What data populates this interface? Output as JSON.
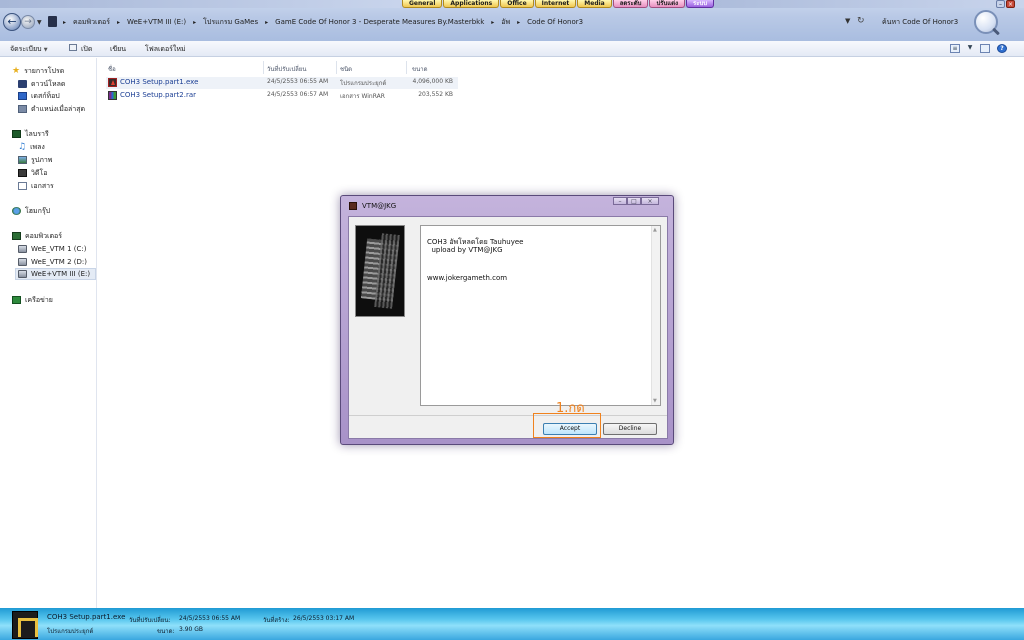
{
  "launcher": {
    "tabs": [
      "General",
      "Applications",
      "Office",
      "Internet",
      "Media",
      "ลดระดับ",
      "ปรับแต่ง",
      "ระบบ"
    ]
  },
  "address_bar": {
    "breadcrumb": [
      "คอมพิวเตอร์",
      "WeE+VTM III (E:)",
      "โปรแกรม GaMes",
      "GamE Code Of Honor 3 - Desperate Measures By.Masterbkk",
      "อัพ",
      "Code Of Honor3"
    ],
    "search_placeholder": "ค้นหา Code Of Honor3"
  },
  "command_bar": {
    "organize": "จัดระเบียบ",
    "open": "เปิด",
    "burn": "เขียน",
    "new_folder": "โฟลเดอร์ใหม่"
  },
  "sidebar": {
    "favorites": {
      "label": "รายการโปรด",
      "items": [
        "ดาวน์โหลด",
        "เดสก์ท็อป",
        "ตำแหน่งเมื่อล่าสุด"
      ]
    },
    "libraries": {
      "label": "ไลบรารี",
      "items": [
        "เพลง",
        "รูปภาพ",
        "วิดีโอ",
        "เอกสาร"
      ]
    },
    "homegroup": "โฮมกรุ๊ป",
    "computer": {
      "label": "คอมพิวเตอร์",
      "items": [
        "WeE_VTM 1 (C:)",
        "WeE_VTM 2 (D:)",
        "WeE+VTM III (E:)"
      ]
    },
    "network": "เครือข่าย"
  },
  "file_list": {
    "columns": {
      "name": "ชื่อ",
      "date": "วันที่ปรับเปลี่ยน",
      "type": "ชนิด",
      "size": "ขนาด"
    },
    "rows": [
      {
        "name": "COH3 Setup.part1.exe",
        "date": "24/5/2553 06:55 AM",
        "type": "โปรแกรมประยุกต์",
        "size": "4,096,000 KB"
      },
      {
        "name": "COH3 Setup.part2.rar",
        "date": "24/5/2553 06:57 AM",
        "type": "เอกสาร WinRAR",
        "size": "203,552 KB"
      }
    ]
  },
  "dialog": {
    "title": "VTM@JKG",
    "text_lines": [
      "COH3 อัพโหลดโดย Tauhuyee",
      "  upload by VTM@JKG",
      "www.jokergameth.com"
    ],
    "accept_label": "Accept",
    "decline_label": "Decline",
    "annotation_label": "1.กด",
    "annotation_color": "#f0821e"
  },
  "details_pane": {
    "file_name": "COH3 Setup.part1.exe",
    "file_type": "โปรแกรมประยุกต์",
    "modified_label": "วันที่ปรับเปลี่ยน:",
    "modified_value": "24/5/2553 06:55 AM",
    "created_label": "วันที่สร้าง:",
    "created_value": "26/5/2553 03:17 AM",
    "size_label": "ขนาด:",
    "size_value": "3.90 GB"
  }
}
